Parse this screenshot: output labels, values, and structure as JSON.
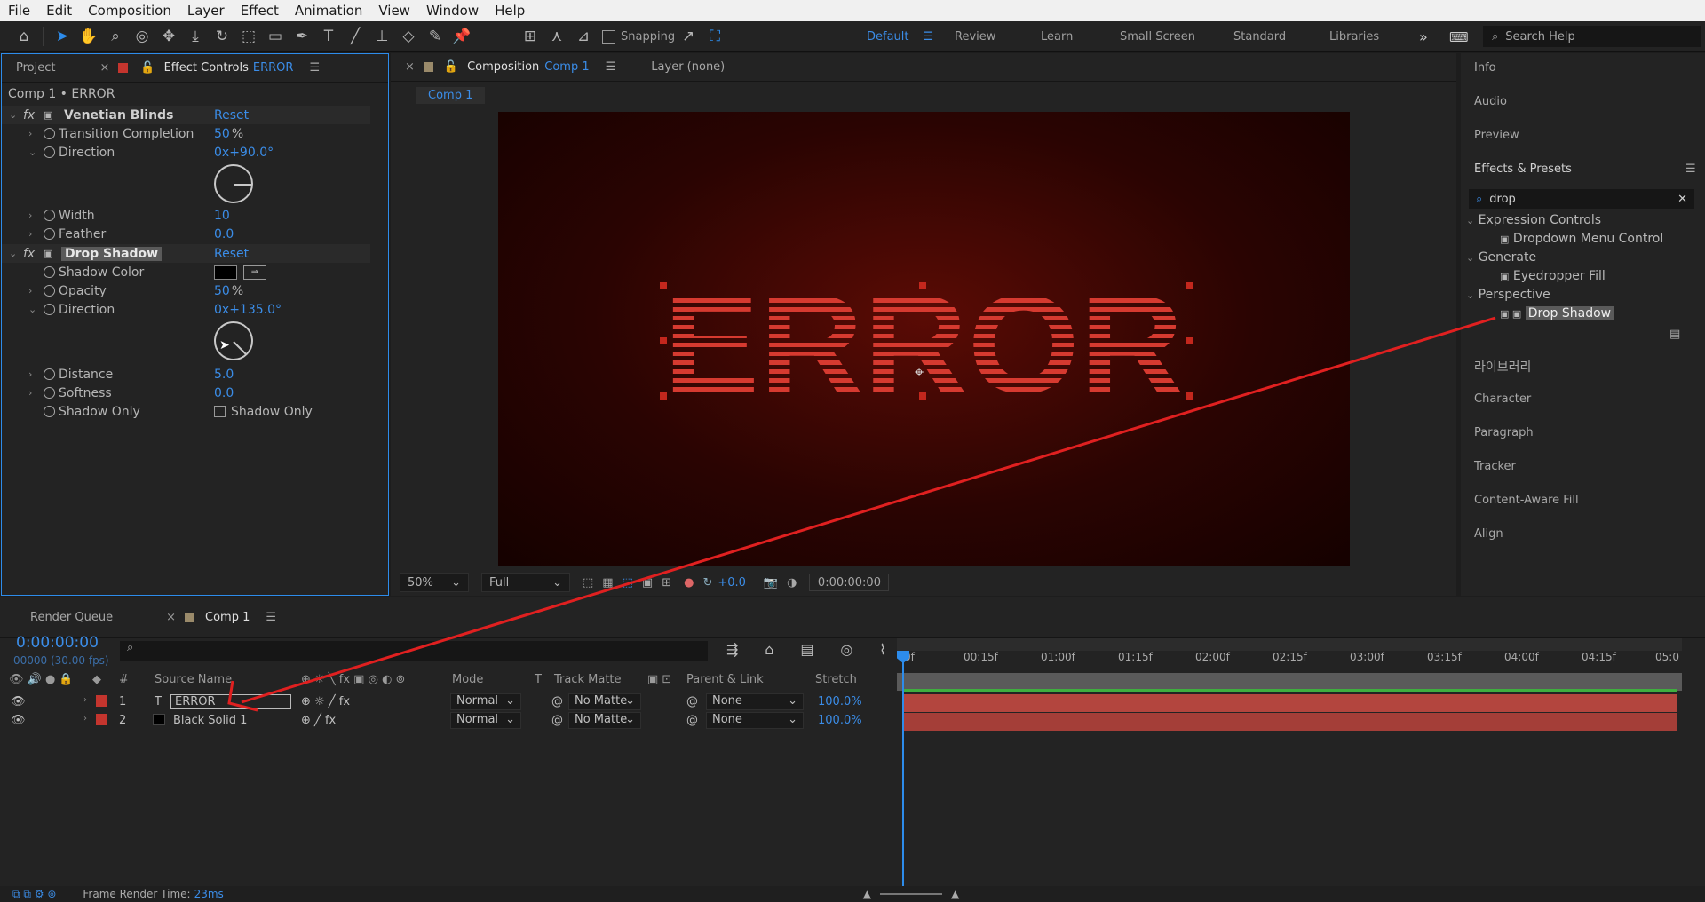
{
  "menu": [
    "File",
    "Edit",
    "Composition",
    "Layer",
    "Effect",
    "Animation",
    "View",
    "Window",
    "Help"
  ],
  "toolbar": {
    "snapping_label": "Snapping",
    "workspaces": [
      "Default",
      "Review",
      "Learn",
      "Small Screen",
      "Standard",
      "Libraries"
    ],
    "more": "»",
    "search_placeholder": "Search Help"
  },
  "left_panel": {
    "tab_project": "Project",
    "tab_effect_controls": "Effect Controls",
    "tab_effect_controls_layer": "ERROR",
    "breadcrumb": "Comp 1 • ERROR",
    "effects": [
      {
        "name": "Venetian Blinds",
        "reset": "Reset",
        "props": [
          {
            "label": "Transition Completion",
            "value": "50",
            "unit": "%"
          },
          {
            "label": "Direction",
            "value": "0x+90.0°",
            "angle": 90
          },
          {
            "label": "Width",
            "value": "10"
          },
          {
            "label": "Feather",
            "value": "0.0"
          }
        ]
      },
      {
        "name": "Drop Shadow",
        "reset": "Reset",
        "props": [
          {
            "label": "Shadow Color",
            "value": "#000000"
          },
          {
            "label": "Opacity",
            "value": "50",
            "unit": "%"
          },
          {
            "label": "Direction",
            "value": "0x+135.0°",
            "angle": 135
          },
          {
            "label": "Distance",
            "value": "5.0"
          },
          {
            "label": "Softness",
            "value": "0.0"
          },
          {
            "label": "Shadow Only",
            "checkbox_label": "Shadow Only",
            "checked": false
          }
        ]
      }
    ]
  },
  "comp_panel": {
    "tab_label": "Composition",
    "comp_name": "Comp 1",
    "layer_tab": "Layer (none)",
    "breadcrumb": "Comp 1",
    "canvas_text": "ERROR",
    "zoom": "50%",
    "resolution": "Full",
    "exposure": "+0.0",
    "timecode": "0:00:00:00"
  },
  "right_panel": {
    "items_top": [
      "Info",
      "Audio",
      "Preview"
    ],
    "effects_presets_title": "Effects & Presets",
    "search_value": "drop",
    "tree": [
      {
        "group": "Expression Controls",
        "item": "Dropdown Menu Control"
      },
      {
        "group": "Generate",
        "item": "Eyedropper Fill"
      },
      {
        "group": "Perspective",
        "item": "Drop Shadow"
      }
    ],
    "items_bottom": [
      "라이브러리",
      "Character",
      "Paragraph",
      "Tracker",
      "Content-Aware Fill",
      "Align"
    ]
  },
  "timeline": {
    "tab_render_queue": "Render Queue",
    "tab_comp": "Comp 1",
    "timecode": "0:00:00:00",
    "frames": "00000 (30.00 fps)",
    "columns": {
      "num": "#",
      "source": "Source Name",
      "mode": "Mode",
      "t": "T",
      "track_matte": "Track Matte",
      "parent": "Parent & Link",
      "stretch": "Stretch"
    },
    "layers": [
      {
        "num": "1",
        "name": "ERROR",
        "mode": "Normal",
        "matte": "No Matte",
        "parent": "None",
        "stretch": "100.0%",
        "color": "#c4352e"
      },
      {
        "num": "2",
        "name": "Black Solid 1",
        "mode": "Normal",
        "matte": "No Matte",
        "parent": "None",
        "stretch": "100.0%",
        "color": "#c4352e"
      }
    ],
    "ruler": [
      "0f",
      "00:15f",
      "01:00f",
      "01:15f",
      "02:00f",
      "02:15f",
      "03:00f",
      "03:15f",
      "04:00f",
      "04:15f",
      "05:0"
    ],
    "footer": "Frame Render Time:",
    "render_time": "23ms"
  }
}
